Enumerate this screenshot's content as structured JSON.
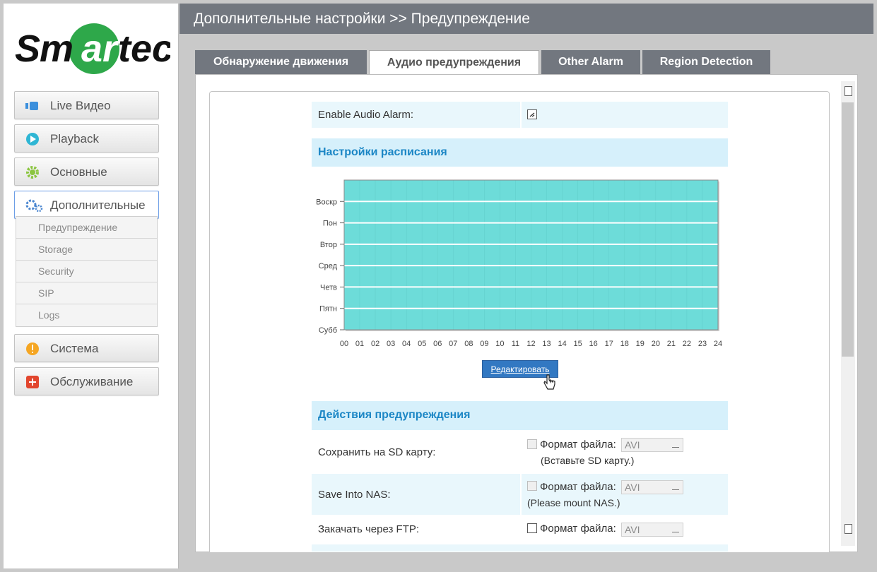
{
  "brand": {
    "logo_text": "Smartec"
  },
  "header": {
    "title": "Дополнительные настройки >> Предупреждение"
  },
  "sidebar": {
    "items": [
      {
        "label": "Live Видео",
        "icon": "video-icon"
      },
      {
        "label": "Playback",
        "icon": "play-icon"
      },
      {
        "label": "Основные",
        "icon": "gear-icon"
      },
      {
        "label": "Дополнительные",
        "icon": "gears-icon",
        "active": true
      },
      {
        "label": "Система",
        "icon": "warning-icon"
      },
      {
        "label": "Обслуживание",
        "icon": "plus-icon"
      }
    ],
    "submenu": [
      "Предупреждение",
      "Storage",
      "Security",
      "SIP",
      "Logs"
    ]
  },
  "tabs": [
    {
      "label": "Обнаружение движения"
    },
    {
      "label": "Аудио предупреждения",
      "active": true
    },
    {
      "label": "Other Alarm"
    },
    {
      "label": "Region Detection"
    }
  ],
  "form": {
    "enable_audio_label": "Enable Audio Alarm:",
    "schedule_title": "Настройки расписания",
    "edit_button": "Редактировать",
    "actions_title": "Действия предупреждения",
    "sd_label": "Сохранить на SD карту:",
    "sd_format_label": "Формат файла:",
    "sd_format_value": "AVI",
    "sd_hint": "(Вставьте SD карту.)",
    "nas_label": "Save Into NAS:",
    "nas_format_label": "Формат файла:",
    "nas_format_value": "AVI",
    "nas_hint": "(Please mount NAS.)",
    "ftp_label": "Закачать через FTP:",
    "ftp_format_label": "Формат файла:",
    "ftp_format_value": "AVI"
  },
  "chart_data": {
    "type": "heatmap",
    "days": [
      "Воскр",
      "Пон",
      "Втор",
      "Сред",
      "Четв",
      "Пятн",
      "Субб"
    ],
    "hours": [
      "00",
      "01",
      "02",
      "03",
      "04",
      "05",
      "06",
      "07",
      "08",
      "09",
      "10",
      "11",
      "12",
      "13",
      "14",
      "15",
      "16",
      "17",
      "18",
      "19",
      "20",
      "21",
      "22",
      "23",
      "24"
    ],
    "fill_color": "#6ddcd9",
    "all_hours_scheduled": true
  },
  "colors": {
    "accent": "#1b86c5",
    "header": "#72777f",
    "schedule": "#6ddcd9"
  }
}
